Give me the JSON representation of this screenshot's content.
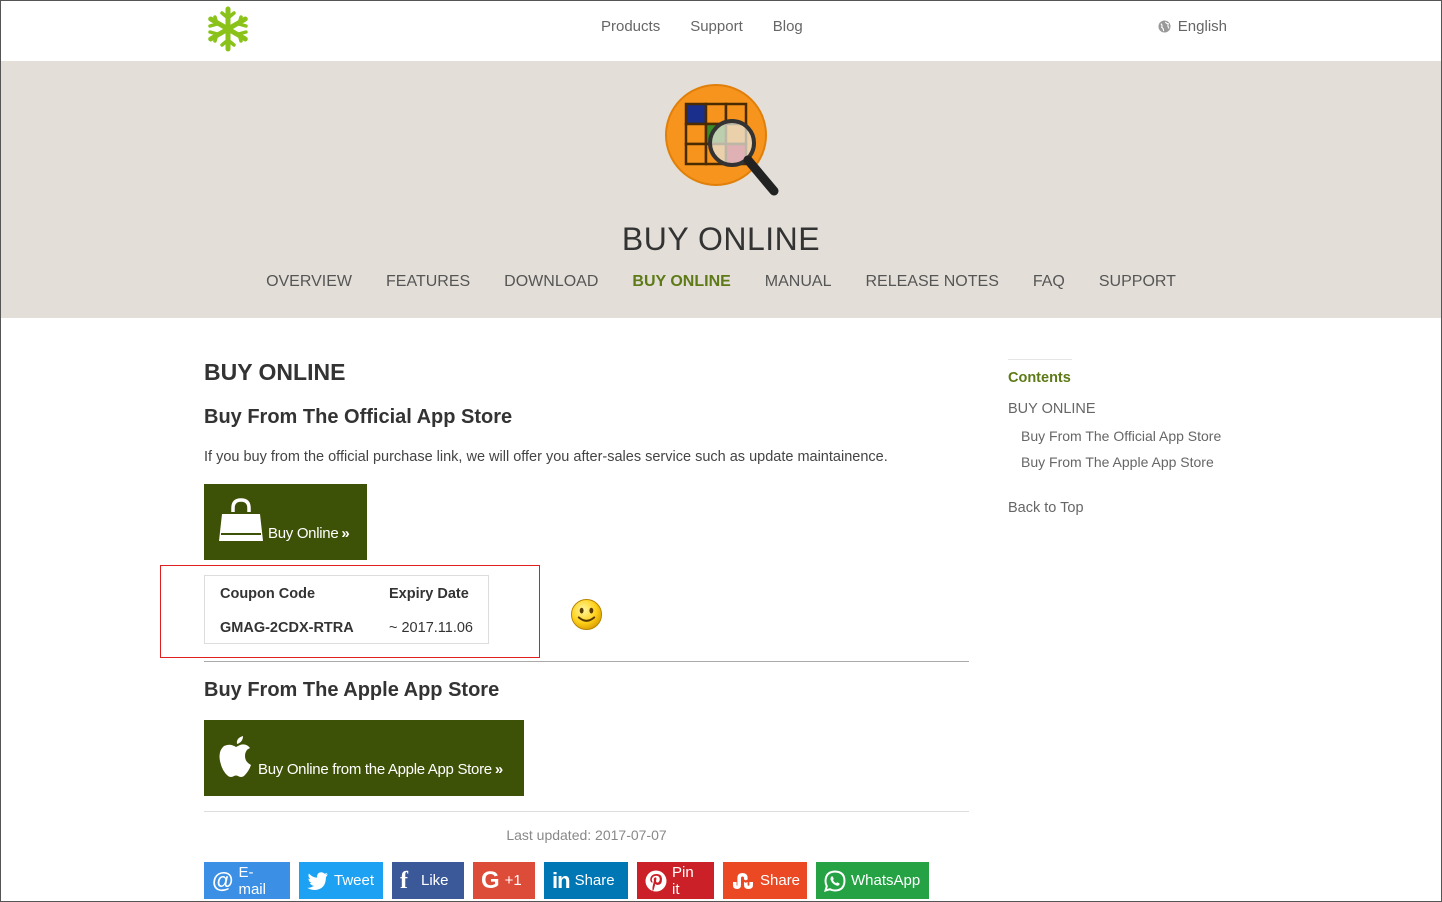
{
  "topnav": {
    "items": [
      "Products",
      "Support",
      "Blog"
    ],
    "language": "English"
  },
  "hero": {
    "title": "BUY ONLINE",
    "tabs": [
      "OVERVIEW",
      "FEATURES",
      "DOWNLOAD",
      "BUY ONLINE",
      "MANUAL",
      "RELEASE NOTES",
      "FAQ",
      "SUPPORT"
    ],
    "active_tab": "BUY ONLINE"
  },
  "main": {
    "heading": "BUY ONLINE",
    "official_heading": "Buy From The Official App Store",
    "official_text": "If you buy from the official purchase link, we will offer you after-sales service such as update maintainence.",
    "buy_online_label": "Buy Online",
    "coupon": {
      "code_header": "Coupon Code",
      "expiry_header": "Expiry Date",
      "code": "GMAG-2CDX-RTRA",
      "expiry": "~ 2017.11.06"
    },
    "apple_heading": "Buy From The Apple App Store",
    "apple_button_label": "Buy Online from the Apple App Store",
    "last_updated": "Last updated: 2017-07-07"
  },
  "share": [
    {
      "label": "E-mail",
      "icon": "at-icon",
      "color": "#3b8fe4"
    },
    {
      "label": "Tweet",
      "icon": "twitter-icon",
      "color": "#1da1f2"
    },
    {
      "label": "Like",
      "icon": "facebook-icon",
      "color": "#3b5998"
    },
    {
      "label": "+1",
      "icon": "google-plus-icon",
      "color": "#dd4b39"
    },
    {
      "label": "Share",
      "icon": "linkedin-icon",
      "color": "#0077b5"
    },
    {
      "label": "Pin it",
      "icon": "pinterest-icon",
      "color": "#cb2027"
    },
    {
      "label": "Share",
      "icon": "stumbleupon-icon",
      "color": "#eb4924"
    },
    {
      "label": "WhatsApp",
      "icon": "whatsapp-icon",
      "color": "#25a244"
    }
  ],
  "sidebar": {
    "title": "Contents",
    "items": [
      "BUY ONLINE"
    ],
    "subitems": [
      "Buy From The Official App Store",
      "Buy From The Apple App Store"
    ],
    "back_to_top": "Back to Top"
  },
  "colors": {
    "accent_green": "#5d7a16",
    "button_green": "#3e5207",
    "hero_bg": "#e3dfd8",
    "highlight_red": "#e02020"
  }
}
